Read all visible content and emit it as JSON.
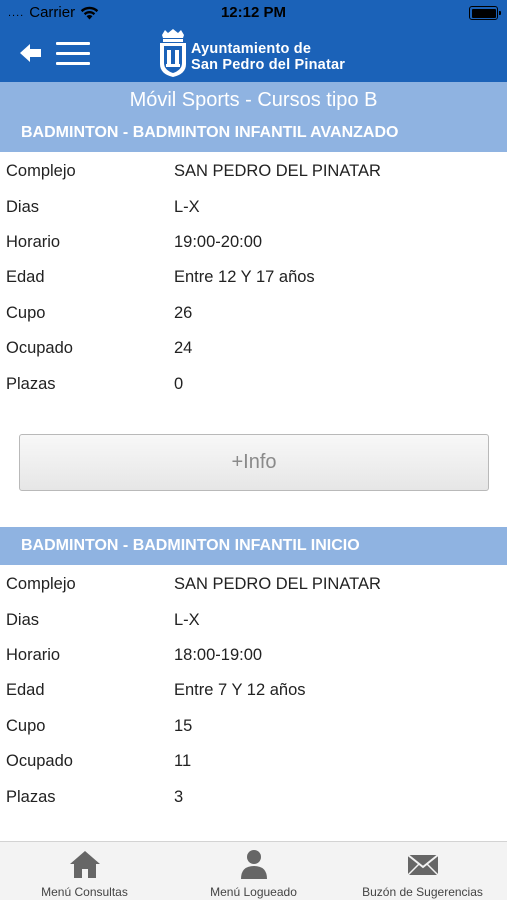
{
  "status_bar": {
    "dots": "....",
    "carrier": "Carrier",
    "time": "12:12 PM"
  },
  "header": {
    "brand_line1": "Ayuntamiento de",
    "brand_line2": "San Pedro del Pinatar"
  },
  "page": {
    "title": "Móvil Sports - Cursos tipo B"
  },
  "courses": [
    {
      "name": "BADMINTON - BADMINTON INFANTIL AVANZADO",
      "rows": [
        {
          "label": "Complejo",
          "value": "SAN PEDRO DEL PINATAR"
        },
        {
          "label": "Dias",
          "value": "L-X"
        },
        {
          "label": "Horario",
          "value": "19:00-20:00"
        },
        {
          "label": "Edad",
          "value": "Entre 12 Y 17 años"
        },
        {
          "label": "Cupo",
          "value": "26"
        },
        {
          "label": "Ocupado",
          "value": "24"
        },
        {
          "label": "Plazas",
          "value": "0"
        }
      ],
      "button_label": "+Info"
    },
    {
      "name": "BADMINTON - BADMINTON INFANTIL INICIO",
      "rows": [
        {
          "label": "Complejo",
          "value": "SAN PEDRO DEL PINATAR"
        },
        {
          "label": "Dias",
          "value": "L-X"
        },
        {
          "label": "Horario",
          "value": "18:00-19:00"
        },
        {
          "label": "Edad",
          "value": "Entre 7 Y 12 años"
        },
        {
          "label": "Cupo",
          "value": "15"
        },
        {
          "label": "Ocupado",
          "value": "11"
        },
        {
          "label": "Plazas",
          "value": "3"
        }
      ]
    }
  ],
  "tabbar": {
    "items": [
      {
        "label": "Menú Consultas",
        "icon": "home-icon"
      },
      {
        "label": "Menú Logueado",
        "icon": "user-icon"
      },
      {
        "label": "Buzón de Sugerencias",
        "icon": "mail-icon"
      }
    ]
  },
  "colors": {
    "header_blue": "#1b62b8",
    "section_blue": "#8fb3e1"
  }
}
